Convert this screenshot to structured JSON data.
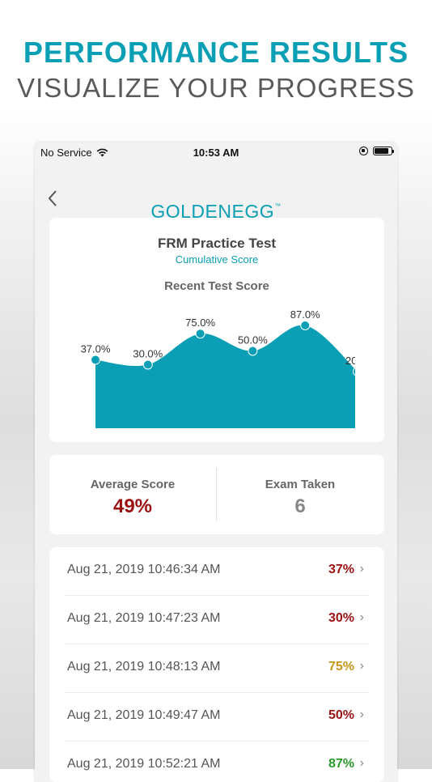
{
  "promo": {
    "headline": "PERFORMANCE RESULTS",
    "subheadline": "VISUALIZE YOUR PROGRESS"
  },
  "status_bar": {
    "carrier": "No Service",
    "time": "10:53 AM",
    "icons": [
      "wifi-icon",
      "orientation-lock-icon",
      "battery-icon"
    ]
  },
  "nav": {
    "back_icon": "chevron-left-icon",
    "logo_text": "GOLDENEGG",
    "logo_mark": "™"
  },
  "chart_card": {
    "title": "FRM Practice Test",
    "subtitle": "Cumulative Score",
    "heading": "Recent Test Score"
  },
  "chart_data": {
    "type": "area",
    "x": [
      1,
      2,
      3,
      4,
      5,
      6
    ],
    "values": [
      37,
      30,
      75,
      50,
      87,
      20
    ],
    "labels": [
      "37.0%",
      "30.0%",
      "75.0%",
      "50.0%",
      "87.0%",
      "20"
    ],
    "color": "#0a9fb4"
  },
  "stats": {
    "average_label": "Average Score",
    "average_value": "49%",
    "average_color": "#9b1010",
    "exams_label": "Exam Taken",
    "exams_value": "6",
    "exams_color": "#888888"
  },
  "results": [
    {
      "date": "Aug 21, 2019 10:46:34 AM",
      "score": "37%",
      "color": "#9b1010"
    },
    {
      "date": "Aug 21, 2019 10:47:23 AM",
      "score": "30%",
      "color": "#9b1010"
    },
    {
      "date": "Aug 21, 2019 10:48:13 AM",
      "score": "75%",
      "color": "#c8961a"
    },
    {
      "date": "Aug 21, 2019 10:49:47 AM",
      "score": "50%",
      "color": "#9b1010"
    },
    {
      "date": "Aug 21, 2019 10:52:21 AM",
      "score": "87%",
      "color": "#2a9a2a"
    }
  ]
}
